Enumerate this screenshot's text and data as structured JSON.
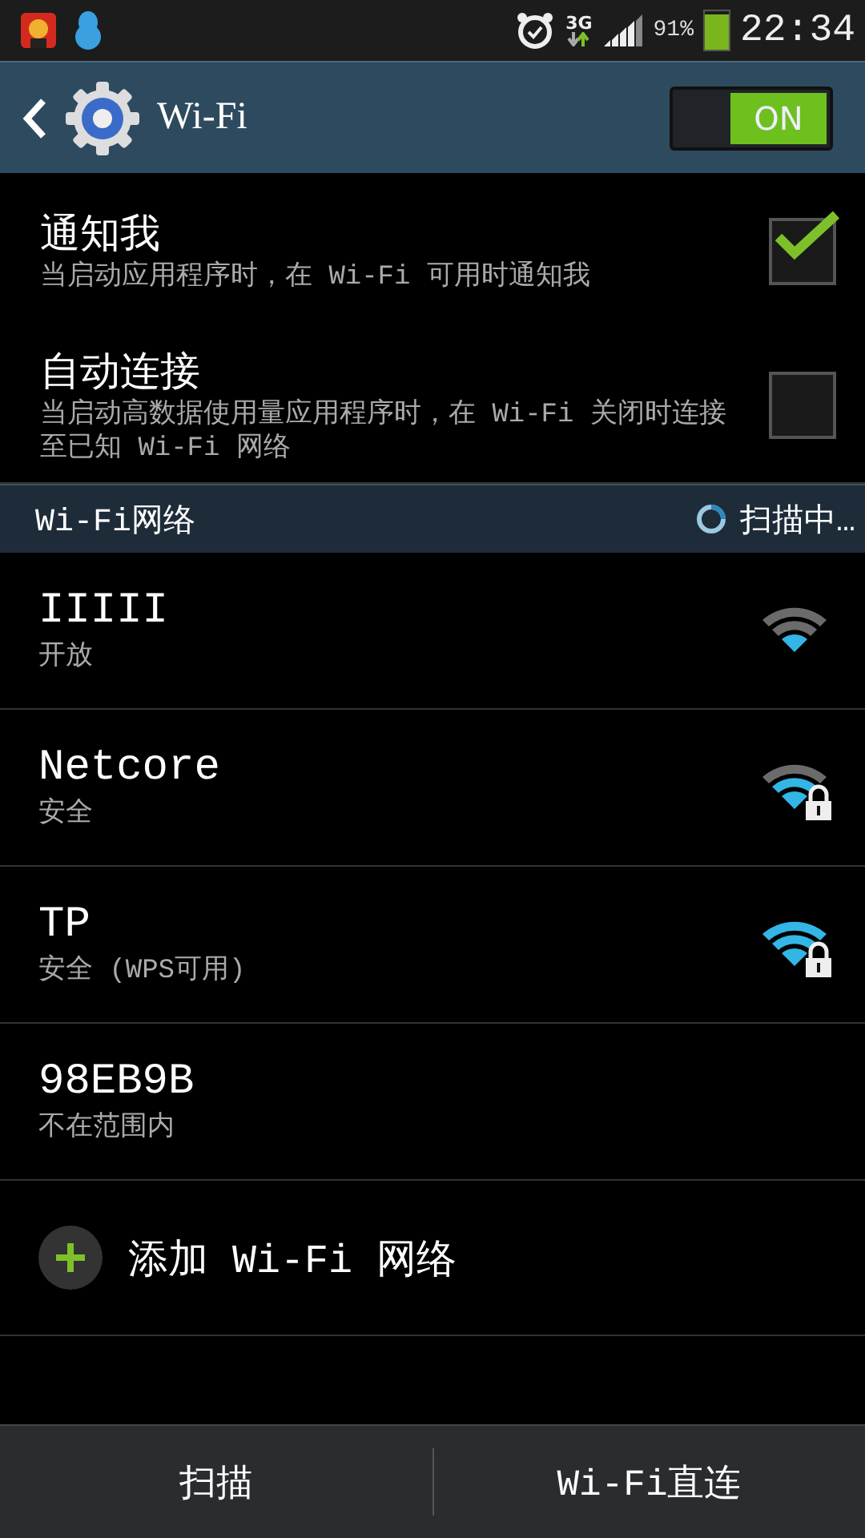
{
  "status_bar": {
    "network": "3G",
    "battery": "91%",
    "time": "22:34"
  },
  "action_bar": {
    "title": "Wi-Fi",
    "toggle": {
      "label": "ON",
      "on": true
    }
  },
  "settings": [
    {
      "title": "通知我",
      "summary": "当启动应用程序时，在 Wi-Fi 可用时通知我",
      "checked": true
    },
    {
      "title": "自动连接",
      "summary": "当启动高数据使用量应用程序时，在 Wi-Fi 关闭时连接至已知 Wi-Fi 网络",
      "checked": false
    }
  ],
  "section": {
    "title": "Wi-Fi网络",
    "status": "扫描中…"
  },
  "networks": [
    {
      "name": "IIIII",
      "status": "开放",
      "kind": "weak"
    },
    {
      "name": "Netcore",
      "status": "安全",
      "kind": "medium-locked"
    },
    {
      "name": "TP",
      "status": "安全 (WPS可用)",
      "kind": "strong-locked"
    },
    {
      "name": "98EB9B",
      "status": "不在范围内",
      "kind": "unavailable"
    }
  ],
  "add_network": "添加 Wi-Fi 网络",
  "bottom_buttons": [
    "扫描",
    "Wi-Fi直连"
  ]
}
